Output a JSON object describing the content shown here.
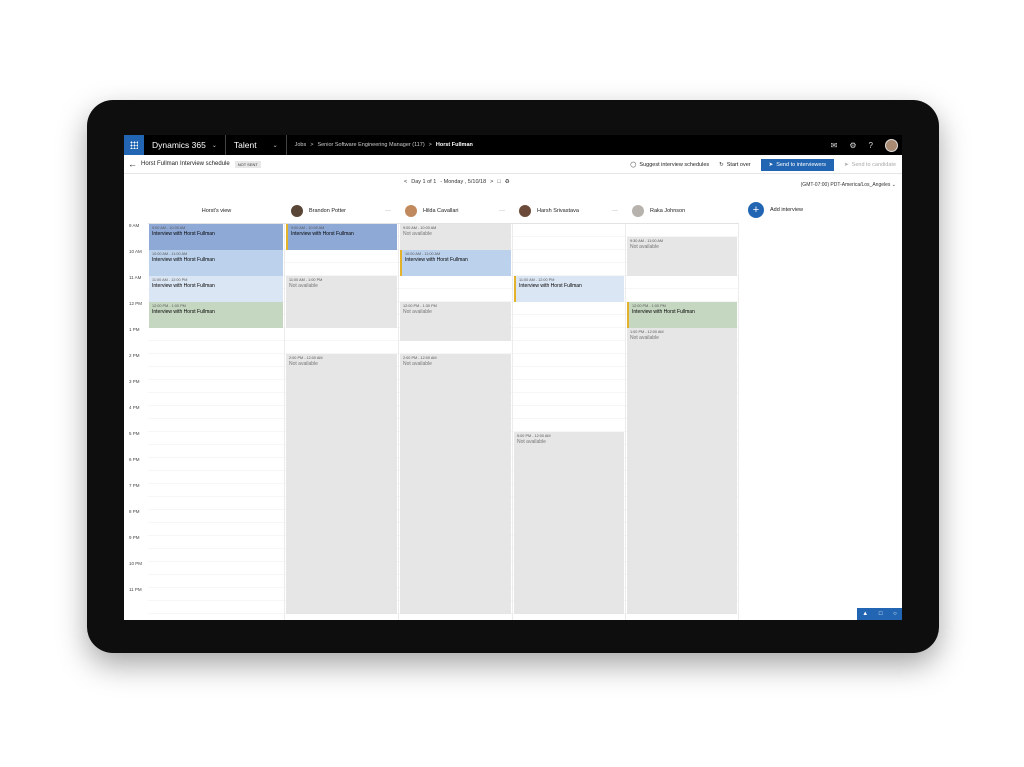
{
  "app": {
    "name": "Dynamics 365",
    "module": "Talent",
    "breadcrumb": [
      "Jobs",
      "Senior Software Engineering Manager (117)",
      "Horst Fullman"
    ]
  },
  "command_bar": {
    "schedule_title": "Horst Fullman Interview schedule",
    "status_badge": "NOT SENT",
    "suggest": "Suggest interview schedules",
    "start_over": "Start over",
    "send_interviewers": "Send to interviewers",
    "send_candidate": "Send to candidate"
  },
  "day_nav": {
    "label": "Day 1 of 1",
    "date": "- Monday , 5/10/18",
    "timezone": "(GMT-07:00) PDT-America/Los_Angeles"
  },
  "time_labels": [
    "9 AM",
    "10 AM",
    "11 AM",
    "12 PM",
    "1 PM",
    "2 PM",
    "3 PM",
    "4 PM",
    "5 PM",
    "6 PM",
    "7 PM",
    "8 PM",
    "9 PM",
    "10 PM",
    "11 PM"
  ],
  "columns": [
    {
      "name": "Horst's view",
      "avatar": false,
      "more": false,
      "avatar_color": ""
    },
    {
      "name": "Brandon Potter",
      "avatar": true,
      "more": true,
      "avatar_color": "#5a4636"
    },
    {
      "name": "Hilda Cavallari",
      "avatar": true,
      "more": true,
      "avatar_color": "#c08a5e"
    },
    {
      "name": "Harsh Srivastava",
      "avatar": true,
      "more": true,
      "avatar_color": "#6b4a3a"
    },
    {
      "name": "Raka Johnson",
      "avatar": true,
      "more": false,
      "avatar_color": "#b7b2ac"
    }
  ],
  "add_interview": "Add interview",
  "colors": {
    "interview_1": "#8fa9d6",
    "interview_2": "#bcd2ec",
    "interview_3": "#dbe6f4",
    "interview_4": "#c5d7c0",
    "unavailable": "#e6e6e6",
    "accent": "#2266b3",
    "accent_border": "#e3b12a"
  },
  "events": [
    {
      "col": 0,
      "start": 9,
      "end": 10,
      "time": "9:00 AM - 10:00 AM",
      "label": "Interview with Horst Fullman",
      "kind": "interview_1"
    },
    {
      "col": 0,
      "start": 10,
      "end": 11,
      "time": "10:00 AM - 11:00 AM",
      "label": "Interview with Horst Fullman",
      "kind": "interview_2"
    },
    {
      "col": 0,
      "start": 11,
      "end": 12,
      "time": "11:00 AM - 12:00 PM",
      "label": "Interview with Horst Fullman",
      "kind": "interview_3"
    },
    {
      "col": 0,
      "start": 12,
      "end": 13,
      "time": "12:00 PM - 1:00 PM",
      "label": "Interview with Horst Fullman",
      "kind": "interview_4"
    },
    {
      "col": 1,
      "start": 9,
      "end": 10,
      "time": "9:00 AM - 10:00 AM",
      "label": "Interview with Horst Fullman",
      "kind": "interview_1",
      "bar": true
    },
    {
      "col": 1,
      "start": 11,
      "end": 13,
      "time": "11:00 AM - 1:00 PM",
      "label": "Not available",
      "kind": "unavailable"
    },
    {
      "col": 1,
      "start": 14,
      "end": 24,
      "time": "2:00 PM - 12:00 AM",
      "label": "Not available",
      "kind": "unavailable"
    },
    {
      "col": 2,
      "start": 9,
      "end": 10,
      "time": "9:00 AM - 10:00 AM",
      "label": "Not available",
      "kind": "unavailable"
    },
    {
      "col": 2,
      "start": 10,
      "end": 11,
      "time": "10:00 AM - 11:00 AM",
      "label": "Interview with Horst Fullman",
      "kind": "interview_2",
      "bar": true
    },
    {
      "col": 2,
      "start": 12,
      "end": 13.5,
      "time": "12:00 PM - 1:30 PM",
      "label": "Not available",
      "kind": "unavailable"
    },
    {
      "col": 2,
      "start": 14,
      "end": 24,
      "time": "2:00 PM - 12:00 AM",
      "label": "Not available",
      "kind": "unavailable"
    },
    {
      "col": 3,
      "start": 11,
      "end": 12,
      "time": "11:00 AM - 12:00 PM",
      "label": "Interview with Horst Fullman",
      "kind": "interview_3",
      "bar": true
    },
    {
      "col": 3,
      "start": 17,
      "end": 24,
      "time": "5:00 PM - 12:00 AM",
      "label": "Not available",
      "kind": "unavailable"
    },
    {
      "col": 4,
      "start": 9.5,
      "end": 11,
      "time": "9:30 AM - 11:00 AM",
      "label": "Not available",
      "kind": "unavailable"
    },
    {
      "col": 4,
      "start": 12,
      "end": 13,
      "time": "12:00 PM - 1:00 PM",
      "label": "Interview with Horst Fullman",
      "kind": "interview_4",
      "bar": true
    },
    {
      "col": 4,
      "start": 13,
      "end": 24,
      "time": "1:00 PM - 12:00 AM",
      "label": "Not available",
      "kind": "unavailable"
    }
  ]
}
